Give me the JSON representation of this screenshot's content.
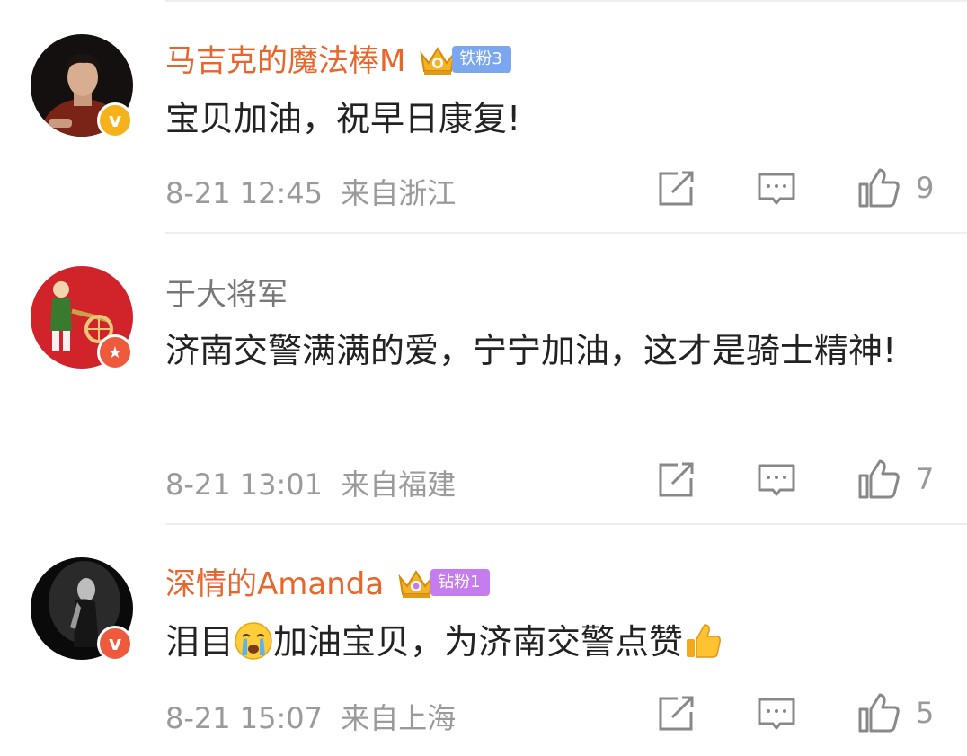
{
  "comments": [
    {
      "username": "马吉克的魔法棒M",
      "fan_badge": "铁粉3",
      "text": "宝贝加油，祝早日康复!",
      "date": "8-21 12:45",
      "location": "来自浙江",
      "likes": "9"
    },
    {
      "username": "于大将军",
      "text": "济南交警满满的爱，宁宁加油，这才是骑士精神!",
      "date": "8-21 13:01",
      "location": "来自福建",
      "likes": "7"
    },
    {
      "username": "深情的Amanda",
      "fan_badge": "钻粉1",
      "text_before": "泪目",
      "text_middle": "加油宝贝，为济南交警点赞",
      "date": "8-21 15:07",
      "location": "来自上海",
      "likes": "5"
    }
  ],
  "icons": {
    "repost": "share-icon",
    "comment": "comment-icon",
    "like": "thumbs-up-icon"
  },
  "colors": {
    "username_vip": "#e8662c",
    "username_normal": "#777777",
    "badge_iron": "#7aa7f0",
    "badge_diamond": "#c57cef",
    "verified_yellow": "#f5b21a",
    "verified_red": "#ef5a3d"
  }
}
